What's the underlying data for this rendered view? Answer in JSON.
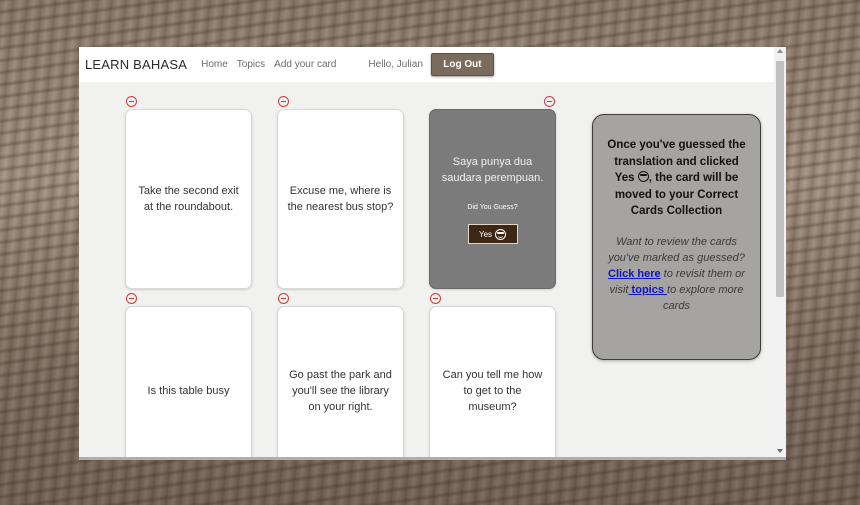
{
  "navbar": {
    "brand": "LEARN BAHASA",
    "links": [
      "Home",
      "Topics",
      "Add your card"
    ],
    "greeting": "Hello, Julian",
    "logout_label": "Log Out"
  },
  "cards": [
    {
      "text": "Take the second exit at the roundabout."
    },
    {
      "text": "Excuse me, where is the nearest bus stop?"
    },
    {
      "text": "Saya punya dua saudara perempuan.",
      "prompt": "Did You Guess?",
      "yes_label": "Yes"
    },
    {
      "text": "Is this table busy"
    },
    {
      "text": "Go past the park and you'll see the library on your right."
    },
    {
      "text": "Can you tell me how to get to the museum?"
    }
  ],
  "info": {
    "bold_before": "Once you've guessed the translation and clicked Yes",
    "bold_after": ", the card will be moved to your Correct Cards Collection",
    "italic": "Want to review the cards you've marked as guessed?",
    "click_here": "Click here",
    "mid_text": " to revisit them or visit",
    "topics_link": " topics ",
    "end_text": "to explore more cards"
  },
  "colors": {
    "accent": "#7a6b5c",
    "yes_button": "#3e2614",
    "flipped_card": "#7b7b7b",
    "info_box": "#a5a4a3",
    "link": "#1111cc",
    "remove": "#d63a3a"
  },
  "icons": [
    "remove-icon",
    "sunglasses-emoji-icon",
    "scroll-up-icon",
    "scroll-down-icon"
  ]
}
